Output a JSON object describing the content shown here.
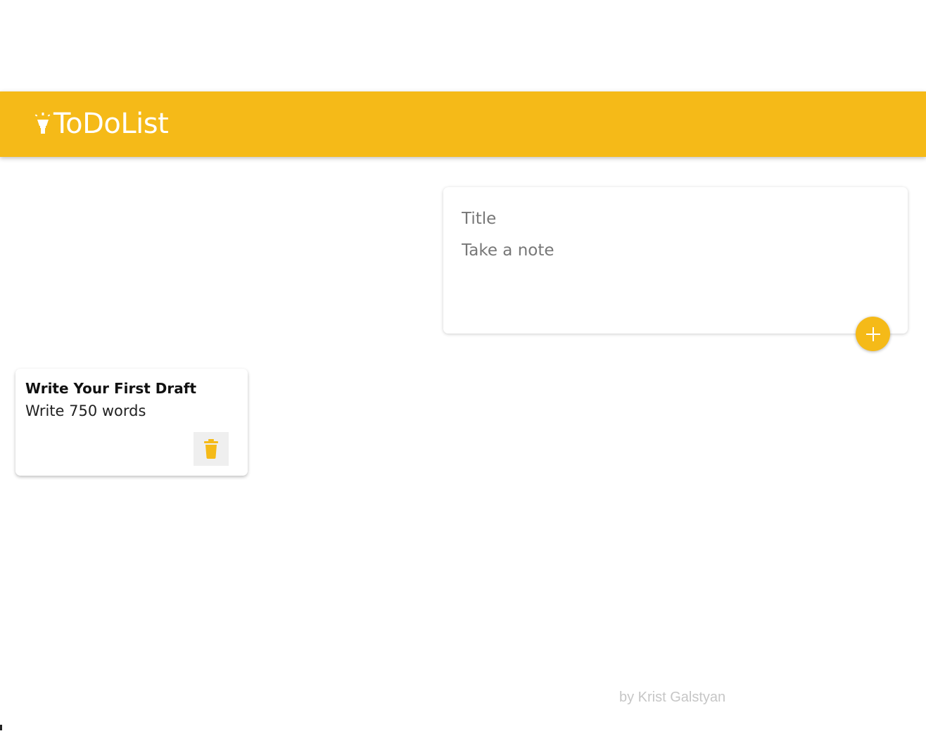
{
  "app": {
    "title": "ToDoList",
    "brand_icon": "lightbulb-icon",
    "accent_color": "#f5ba18"
  },
  "composer": {
    "title_placeholder": "Title",
    "content_placeholder": "Take a note",
    "add_icon": "plus-icon"
  },
  "notes": [
    {
      "title": "Write Your First Draft",
      "content": "Write 750 words",
      "delete_icon": "trash-icon"
    }
  ],
  "footer": {
    "text": "by Krist Galstyan"
  }
}
